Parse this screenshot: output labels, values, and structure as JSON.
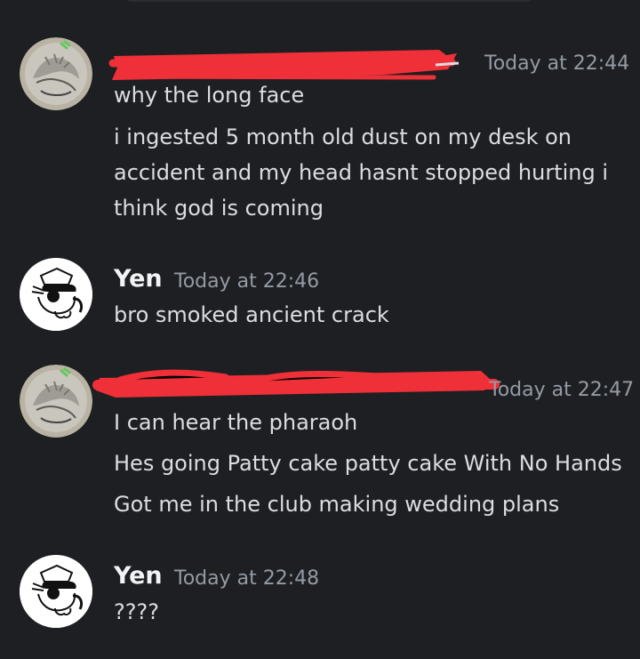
{
  "messages": [
    {
      "author": "",
      "timestamp": "Today at 22:44",
      "lines": [
        "why the long face",
        "i ingested 5 month old dust on my desk on",
        "accident and my head hasnt stopped hurting i",
        "think god is coming"
      ]
    },
    {
      "author": "Yen",
      "timestamp": "Today at 22:46",
      "lines": [
        "bro smoked ancient crack"
      ]
    },
    {
      "author": "",
      "timestamp": "Today at 22:47",
      "lines": [
        "I can hear the pharaoh",
        "Hes going Patty cake patty cake With No Hands",
        "Got me in the club making wedding plans"
      ]
    },
    {
      "author": "Yen",
      "timestamp": "Today at 22:48",
      "lines": [
        "????"
      ]
    }
  ],
  "colors": {
    "background": "#1e1f22",
    "username": "#f2f3f5",
    "timestamp": "#949ba4",
    "message_text": "#dbdee1",
    "redaction": "#f03038"
  },
  "icons": {
    "redacted_avatar": "sketch-avatar-icon",
    "yen_avatar": "yen-character-avatar-icon"
  }
}
